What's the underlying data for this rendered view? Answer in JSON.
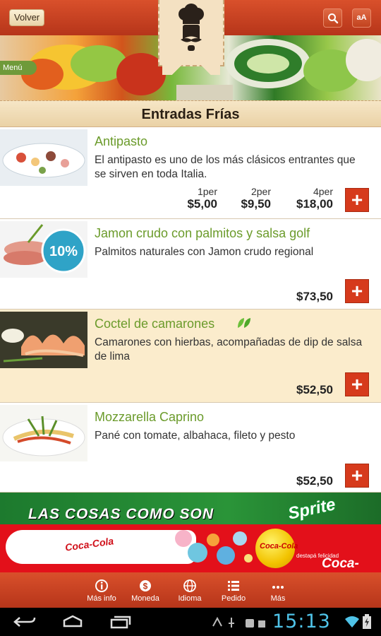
{
  "header": {
    "back_label": "Volver",
    "search_icon": "search-icon",
    "font_size_label": "aA"
  },
  "banner": {
    "menu_label": "Menú"
  },
  "section": {
    "title": "Entradas Frías"
  },
  "items": [
    {
      "name": "Antipasto",
      "description": "El antipasto es uno de los más clásicos entrantes que se sirven en toda Italia.",
      "prices": [
        {
          "label": "1per",
          "value": "$5,00"
        },
        {
          "label": "2per",
          "value": "$9,50"
        },
        {
          "label": "4per",
          "value": "$18,00"
        }
      ]
    },
    {
      "name": "Jamon crudo con palmitos y salsa golf",
      "description": "Palmitos naturales con Jamon crudo regional",
      "badge": "10%",
      "price": "$73,50"
    },
    {
      "name": "Coctel de camarones",
      "description": "Camarones con hierbas, acompañadas de dip de salsa de lima",
      "icon": "leaf-icon",
      "price": "$52,50"
    },
    {
      "name": "Mozzarella Caprino",
      "description": "Pané con tomate, albahaca, fileto y pesto",
      "price": "$52,50"
    }
  ],
  "add_button_label": "+",
  "ads": {
    "slogan": "LAS COSAS COMO SON",
    "brand_top": "Sprite",
    "bottle_brand": "Coca-Cola",
    "ball_brand": "Coca-Cola",
    "tagline": "destapá felicidad",
    "brand_bottom": "Coca-Cola"
  },
  "tabs": [
    {
      "label": "Más info",
      "icon": "info-icon"
    },
    {
      "label": "Moneda",
      "icon": "currency-icon"
    },
    {
      "label": "Idioma",
      "icon": "globe-icon"
    },
    {
      "label": "Pedido",
      "icon": "list-icon"
    },
    {
      "label": "Más",
      "icon": "more-icon"
    }
  ],
  "system": {
    "time": "15:13"
  },
  "colors": {
    "header_red": "#c8401f",
    "accent_green": "#6b9b2b",
    "alt_row": "#fbeccc",
    "add_button": "#d63a1c",
    "clock_blue": "#4fc3e8"
  }
}
